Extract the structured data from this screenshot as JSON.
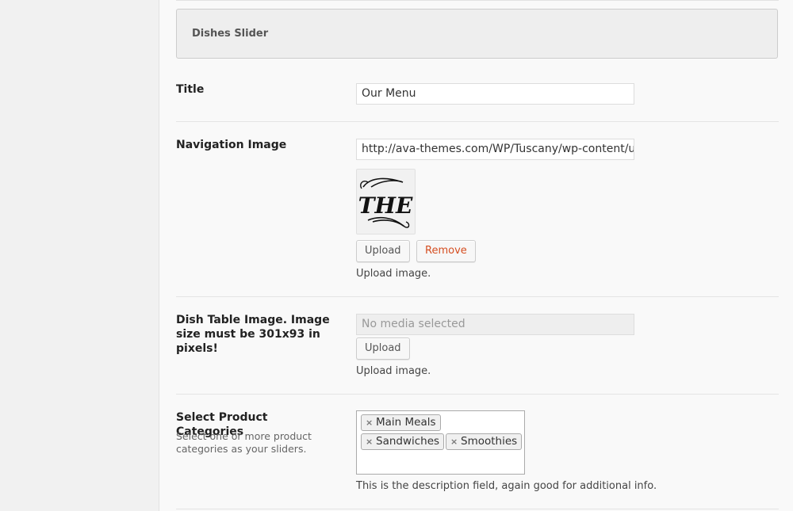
{
  "section": {
    "title": "Dishes Slider"
  },
  "fields": {
    "title": {
      "label": "Title",
      "value": "Our Menu"
    },
    "navigation_image": {
      "label": "Navigation Image",
      "value": "http://ava-themes.com/WP/Tuscany/wp-content/upl",
      "thumbnail_text": "THE",
      "upload_label": "Upload",
      "remove_label": "Remove",
      "help": "Upload image."
    },
    "dish_table_image": {
      "label": "Dish Table Image. Image size must be 301x93 in pixels!",
      "placeholder": "No media selected",
      "upload_label": "Upload",
      "help": "Upload image."
    },
    "product_categories": {
      "label": "Select Product Categories",
      "description": "Select one or more product categories as your sliders.",
      "selected": [
        "Main Meals",
        "Sandwiches",
        "Smoothies"
      ],
      "remove_glyph": "×",
      "help": "This is the description field, again good for additional info."
    }
  },
  "colors": {
    "accent_remove": "#d54e21",
    "header_bg": "#eeeeee",
    "page_bg": "#f9f9f9"
  }
}
